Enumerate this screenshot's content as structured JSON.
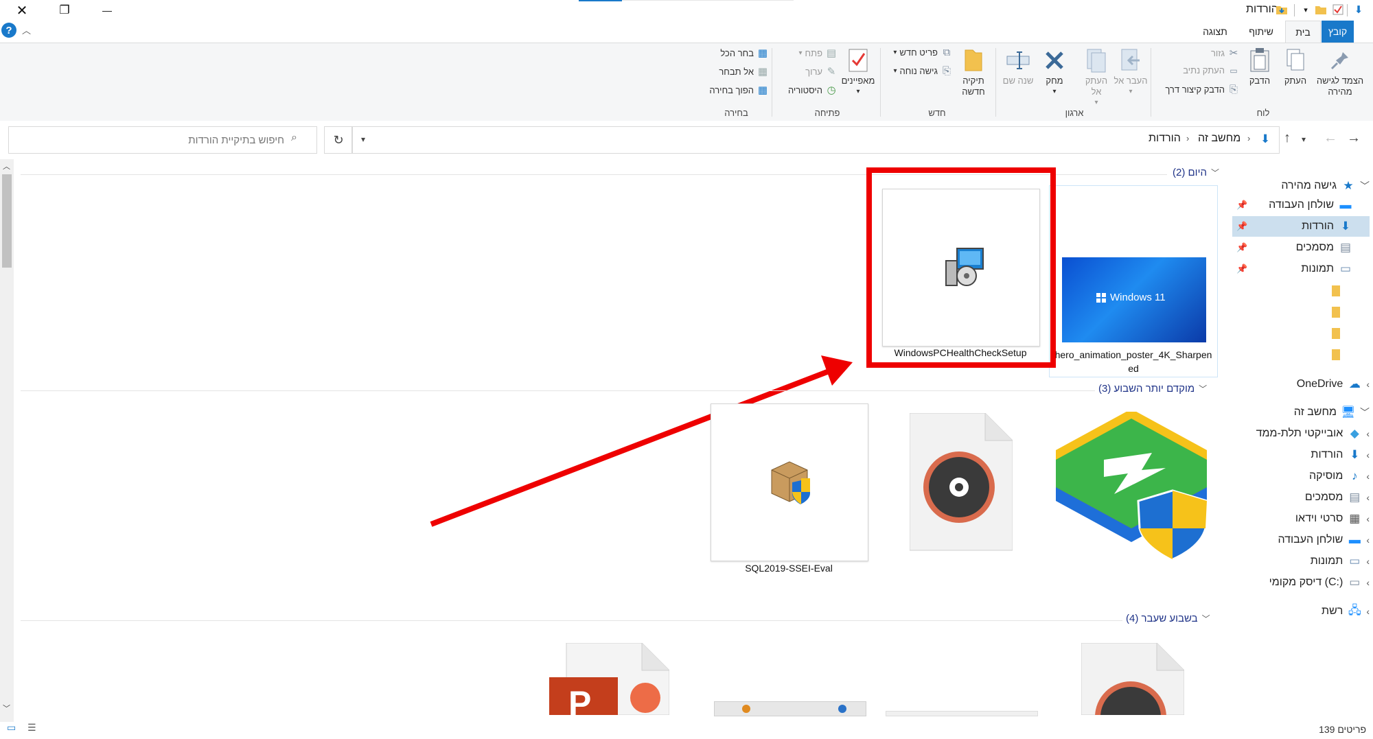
{
  "window": {
    "title": "הורדות",
    "close_glyph": "✕",
    "maximize_glyph": "❐",
    "minimize_glyph": "—"
  },
  "tabs": [
    {
      "label": "קובץ",
      "kind": "file"
    },
    {
      "label": "בית",
      "kind": "active"
    },
    {
      "label": "שיתוף",
      "kind": "normal"
    },
    {
      "label": "תצוגה",
      "kind": "normal"
    }
  ],
  "ribbon": {
    "groups": {
      "clipboard": "לוח",
      "organize": "ארגון",
      "new": "חדש",
      "open": "פתיחה",
      "select": "בחירה"
    },
    "pin_quick_access": "הצמד לגישה מהירה",
    "copy": "העתק",
    "paste": "הדבק",
    "cut": "גזור",
    "copy_path": "העתק נתיב",
    "paste_shortcut": "הדבק קיצור דרך",
    "move_to": "העבר אל",
    "copy_to": "העתק אל",
    "delete": "מחק",
    "rename": "שנה שם",
    "new_folder": "תיקיה חדשה",
    "new_item": "פריט חדש",
    "easy_access": "גישה נוחה",
    "properties": "מאפיינים",
    "open": "פתח",
    "edit": "ערוך",
    "history": "היסטוריה",
    "select_all": "בחר הכל",
    "select_none": "אל תבחר",
    "invert_selection": "הפוך בחירה"
  },
  "address": {
    "crumbs": [
      "מחשב זה",
      "הורדות"
    ],
    "search_placeholder": "חיפוש בתיקיית הורדות"
  },
  "nav_pane": {
    "quick_access": "גישה מהירה",
    "quick_items": [
      "שולחן העבודה",
      "הורדות",
      "מסמכים",
      "תמונות"
    ],
    "onedrive": "OneDrive",
    "this_pc": "מחשב זה",
    "pc_items": [
      "אובייקטי תלת-ממד",
      "הורדות",
      "מוסיקה",
      "מסמכים",
      "סרטי וידאו",
      "שולחן העבודה",
      "תמונות",
      "דיסק מקומי (C:)"
    ],
    "network": "רשת"
  },
  "groups": [
    {
      "heading": "היום (2)",
      "files": [
        "WindowsPCHealthCheckSetup",
        "hero_animation_poster_4K_Sharpened"
      ]
    },
    {
      "heading": "מוקדם יותר השבוע (3)",
      "files": [
        "SQL2019-SSEI-Eval",
        "",
        ""
      ]
    },
    {
      "heading": "בשבוע שעבר (4)",
      "files": [
        "",
        "",
        "",
        ""
      ]
    }
  ],
  "thumbnail_text": "Windows 11",
  "status": {
    "item_count": "139 פריטים"
  },
  "colors": {
    "accent": "#1979ca",
    "highlight_box": "#ee0000",
    "arrow": "#ee0000",
    "folder": "#f2c14e"
  }
}
